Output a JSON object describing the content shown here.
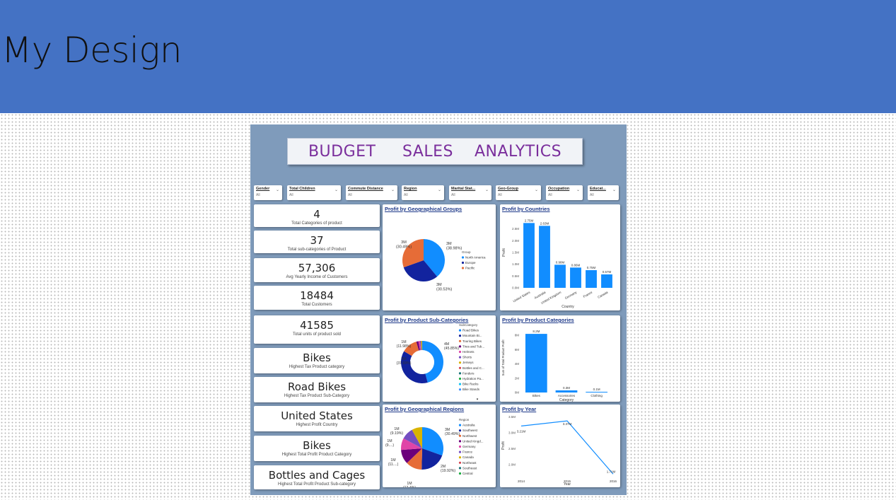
{
  "slide": {
    "title": "My Design"
  },
  "dashboard": {
    "title": "BUDGET     SALES    ANALYTICS",
    "slicers": [
      {
        "label": "Gender",
        "value": "All"
      },
      {
        "label": "Total Children",
        "value": "All"
      },
      {
        "label": "Commute Distance",
        "value": "All"
      },
      {
        "label": "Region",
        "value": "All"
      },
      {
        "label": "Marital Stat...",
        "value": "All"
      },
      {
        "label": "Geo-Group",
        "value": "All"
      },
      {
        "label": "Occupation",
        "value": "All"
      },
      {
        "label": "Educat...",
        "value": "All"
      }
    ],
    "cards": [
      {
        "value": "4",
        "label": "Total Categories of product"
      },
      {
        "value": "37",
        "label": "Total sub-categories of Product"
      },
      {
        "value": "57,306",
        "label": "Avg Yearly Income of Customers"
      },
      {
        "value": "18484",
        "label": "Total Customers"
      },
      {
        "value": "41585",
        "label": "Total units of product sold"
      },
      {
        "value": "Bikes",
        "label": "Highest Tax Product category"
      },
      {
        "value": "Road Bikes",
        "label": "Highest Tax Product Sub-Category"
      },
      {
        "value": "United States",
        "label": "Highest Profit Country"
      },
      {
        "value": "Bikes",
        "label": "Highest Total Profit Product Category"
      },
      {
        "value": "Bottles and Cages",
        "label": "Highest Total Profit Product Sub-category"
      }
    ]
  },
  "chart_data": [
    {
      "type": "pie",
      "title": "Profit by Geographical Groups",
      "legend_title": "Group",
      "slices": [
        {
          "name": "North America",
          "label": "3M\n(38.98%)",
          "value": 38.98,
          "color": "#118dff"
        },
        {
          "name": "Europe",
          "label": "3M\n(30.53%)",
          "value": 30.53,
          "color": "#12239e"
        },
        {
          "name": "Pacific",
          "label": "3M\n(30.49%)",
          "value": 30.49,
          "color": "#e66c37"
        }
      ]
    },
    {
      "type": "bar",
      "title": "Profit by Countries",
      "xlabel": "Country",
      "ylabel": "Profit",
      "categories": [
        "United States",
        "Australia",
        "United Kingdom",
        "Germany",
        "France",
        "Canada"
      ],
      "values": [
        2.75,
        2.63,
        0.98,
        0.86,
        0.75,
        0.57
      ],
      "data_labels": [
        "2.75M",
        "2.63M",
        "0.98M",
        "0.86M",
        "0.75M",
        "0.57M"
      ],
      "yticks": [
        "0.0M",
        "0.5M",
        "1.0M",
        "1.5M",
        "2.0M",
        "2.5M"
      ],
      "ylim": [
        0,
        3.0
      ],
      "color": "#118dff"
    },
    {
      "type": "pie",
      "title": "Profit by Product Sub-Categories",
      "legend_title": "SubCategory",
      "donut": true,
      "legend": [
        "Road Bikes",
        "Mountain Bi...",
        "Touring Bikes",
        "Tires and Tub...",
        "Helmets",
        "Shorts",
        "Jerseys",
        "Bottles and C...",
        "Fenders",
        "Hydration Pa...",
        "Bike Racks",
        "Bike Stands"
      ],
      "legend_colors": [
        "#118dff",
        "#12239e",
        "#e66c37",
        "#6b007b",
        "#e044a7",
        "#744ec2",
        "#d9b300",
        "#d64550",
        "#197278",
        "#1aab40",
        "#15c6f4",
        "#4092ff"
      ],
      "slices": [
        {
          "name": "Road Bikes",
          "label": "4M\n(45.85%)",
          "value": 45.85
        },
        {
          "name": "Mountain Bi...",
          "label": "3M\n(37.69%)",
          "value": 37.69
        },
        {
          "name": "Touring Bikes",
          "label": "1M\n(11.98%)",
          "value": 11.98
        },
        {
          "name": "Tires and Tub...",
          "label": "",
          "value": 1.6
        },
        {
          "name": "Helmets",
          "label": "",
          "value": 1.2
        },
        {
          "name": "Shorts",
          "label": "",
          "value": 0.8
        },
        {
          "name": "Jerseys",
          "label": "",
          "value": 0.88
        }
      ]
    },
    {
      "type": "bar",
      "title": "Profit by Product Categories",
      "xlabel": "Category",
      "ylabel": "Sum of Total Product Profit",
      "categories": [
        "Bikes",
        "Accessories",
        "Clothing"
      ],
      "values": [
        8.2,
        0.3,
        0.1
      ],
      "data_labels": [
        "8.2M",
        "0.3M",
        "0.1M"
      ],
      "yticks": [
        "0M",
        "2M",
        "4M",
        "6M",
        "8M"
      ],
      "ylim": [
        0,
        9
      ],
      "color": "#118dff"
    },
    {
      "type": "pie",
      "title": "Profit by Geographical Regions",
      "legend_title": "Region",
      "legend": [
        "Australia",
        "Southwest",
        "Northwest",
        "United Kingd...",
        "Germany",
        "France",
        "Canada",
        "Northeast",
        "Southeast",
        "Central"
      ],
      "legend_colors": [
        "#118dff",
        "#12239e",
        "#e66c37",
        "#6b007b",
        "#e044a7",
        "#744ec2",
        "#d9b300",
        "#d64550",
        "#197278",
        "#1aab40"
      ],
      "slices": [
        {
          "name": "Australia",
          "label": "3M\n(30.49%)",
          "value": 30.49
        },
        {
          "name": "Southwest",
          "label": "2M\n(19.92%)",
          "value": 19.92
        },
        {
          "name": "Northwest",
          "label": "1M\n(12.4%)",
          "value": 12.4
        },
        {
          "name": "United Kingd...",
          "label": "1M\n(11....)",
          "value": 11.0
        },
        {
          "name": "Germany",
          "label": "1M\n(9....)",
          "value": 9.0
        },
        {
          "name": "France",
          "label": "1M\n(9.19%)",
          "value": 9.19
        },
        {
          "name": "Canada",
          "label": "",
          "value": 8.0
        }
      ]
    },
    {
      "type": "line",
      "title": "Profit by Year",
      "xlabel": "Year",
      "ylabel": "Profit",
      "x": [
        "2014",
        "2015",
        "2016"
      ],
      "values": [
        3.21,
        3.37,
        1.71
      ],
      "data_labels": [
        "3.21M",
        "3.37M",
        "1.71M"
      ],
      "yticks": [
        "2.0M",
        "2.5M",
        "3.0M",
        "3.5M"
      ],
      "ylim": [
        1.65,
        3.55
      ],
      "color": "#118dff"
    }
  ]
}
